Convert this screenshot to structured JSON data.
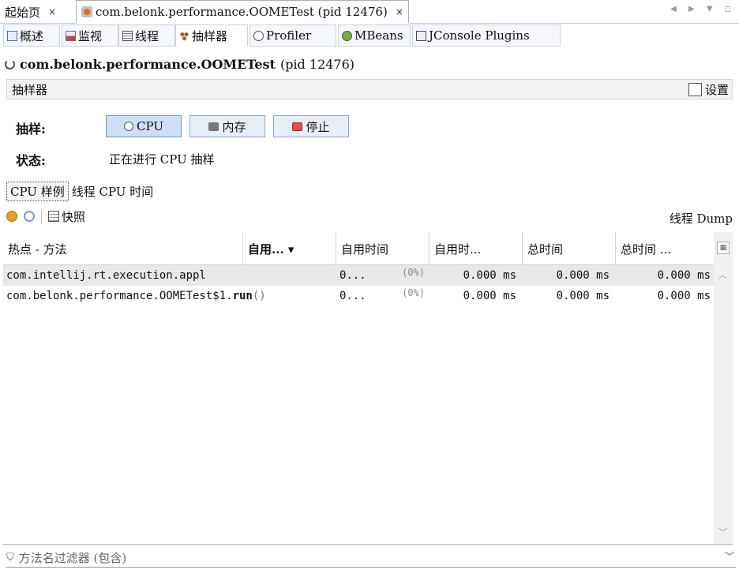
{
  "doc_tabs": [
    {
      "label": "起始页",
      "close": "×",
      "active": false
    },
    {
      "label": "com.belonk.performance.OOMETest (pid 12476)",
      "close": "×",
      "active": true
    }
  ],
  "window_controls": "◀ ▶ ▼ ◻",
  "sub_tabs": [
    {
      "label": "概述",
      "icon": "overview-icon"
    },
    {
      "label": "监视",
      "icon": "monitor-icon"
    },
    {
      "label": "线程",
      "icon": "threads-icon"
    },
    {
      "label": "抽样器",
      "icon": "sampler-icon",
      "active": true
    },
    {
      "label": "Profiler",
      "icon": "profiler-icon"
    },
    {
      "label": "MBeans",
      "icon": "mbeans-icon"
    },
    {
      "label": "JConsole Plugins",
      "icon": "plugins-icon"
    }
  ],
  "process": {
    "main": "com.belonk.performance.OOMETest",
    "pid": "(pid 12476)"
  },
  "section": {
    "title": "抽样器",
    "settings_label": "设置"
  },
  "sampler": {
    "sample_label": "抽样:",
    "cpu_button": "CPU",
    "memory_button": "内存",
    "stop_button": "停止",
    "status_label": "状态:",
    "status_value": "正在进行 CPU 抽样"
  },
  "result_tabs": [
    "CPU 样例",
    "线程 CPU 时间"
  ],
  "toolbar": {
    "snapshot_label": "快照",
    "thread_dump": "线程 Dump"
  },
  "table": {
    "columns": [
      "热点 - 方法",
      "自用... ▾",
      "自用时间",
      "自用时...",
      "总时间",
      "总时间 ..."
    ],
    "rows": [
      {
        "method": "com.intellij.rt.execution.appl",
        "method_bold": "",
        "method_suffix": "",
        "self": "0...",
        "pct": "(0%)",
        "self_cpu": "0.000 ms",
        "total": "0.000 ms",
        "total_cpu": "0.000 ms"
      },
      {
        "method": "com.belonk.performance.OOMETest$1.",
        "method_bold": "run",
        "method_suffix": " ()",
        "self": "0...",
        "pct": "(0%)",
        "self_cpu": "0.000 ms",
        "total": "0.000 ms",
        "total_cpu": "0.000 ms"
      }
    ]
  },
  "filter": {
    "placeholder": "方法名过滤器 (包含)"
  }
}
